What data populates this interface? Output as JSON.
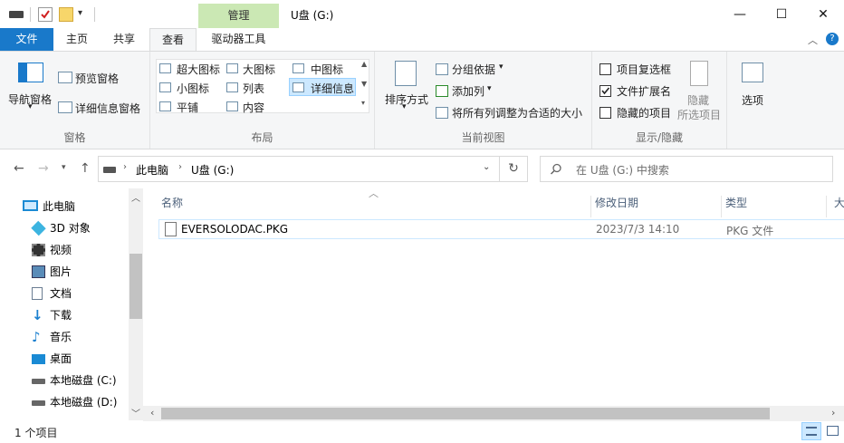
{
  "window": {
    "title": "U盘 (G:)",
    "context_header": "管理",
    "minimize": "—",
    "maximize": "☐",
    "close": "✕"
  },
  "tabs": {
    "file": "文件",
    "home": "主页",
    "share": "共享",
    "view": "查看",
    "drive_tools": "驱动器工具"
  },
  "ribbon": {
    "panes": {
      "label": "窗格",
      "nav_pane": "导航窗格",
      "preview_pane": "预览窗格",
      "details_pane": "详细信息窗格"
    },
    "layout": {
      "label": "布局",
      "extra_large": "超大图标",
      "large": "大图标",
      "medium": "中图标",
      "small": "小图标",
      "list": "列表",
      "details": "详细信息",
      "tiles": "平铺",
      "content": "内容"
    },
    "current_view": {
      "label": "当前视图",
      "sort_by": "排序方式",
      "group_by": "分组依据",
      "add_columns": "添加列",
      "size_all_columns": "将所有列调整为合适的大小"
    },
    "show_hide": {
      "label": "显示/隐藏",
      "item_checkboxes": "项目复选框",
      "file_extensions": "文件扩展名",
      "hidden_items": "隐藏的项目",
      "hide_selected": "隐藏",
      "hide_selected2": "所选项目",
      "item_checkboxes_checked": false,
      "file_extensions_checked": true,
      "hidden_items_checked": false
    },
    "options": "选项"
  },
  "address": {
    "path": [
      "此电脑",
      "U盘 (G:)"
    ],
    "search_placeholder": "在 U盘 (G:) 中搜索"
  },
  "nav": {
    "items": [
      {
        "label": "此电脑",
        "icon": "computer-icon"
      },
      {
        "label": "3D 对象",
        "icon": "3d-objects-icon"
      },
      {
        "label": "视频",
        "icon": "video-icon"
      },
      {
        "label": "图片",
        "icon": "pictures-icon"
      },
      {
        "label": "文档",
        "icon": "documents-icon"
      },
      {
        "label": "下载",
        "icon": "downloads-icon"
      },
      {
        "label": "音乐",
        "icon": "music-icon"
      },
      {
        "label": "桌面",
        "icon": "desktop-icon"
      },
      {
        "label": "本地磁盘 (C:)",
        "icon": "drive-icon"
      },
      {
        "label": "本地磁盘 (D:)",
        "icon": "drive-icon"
      }
    ]
  },
  "files": {
    "columns": {
      "name": "名称",
      "modified": "修改日期",
      "type": "类型",
      "size": "大"
    },
    "rows": [
      {
        "name": "EVERSOLODAC.PKG",
        "modified": "2023/7/3 14:10",
        "type": "PKG 文件"
      }
    ]
  },
  "status": {
    "count": "1 个项目"
  },
  "colors": {
    "file_tab": "#1979ca",
    "context_header": "#cbe8b4",
    "selection": "#cce8ff"
  }
}
